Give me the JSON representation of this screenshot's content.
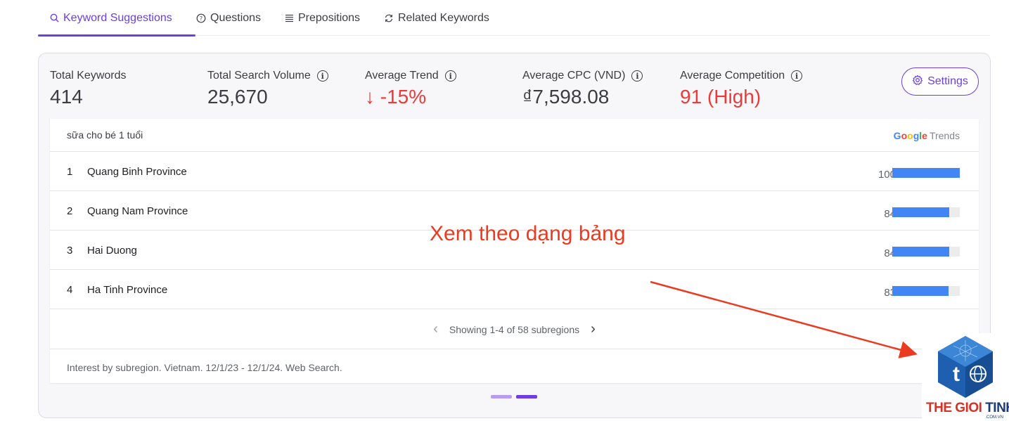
{
  "tabs": [
    {
      "label": "Keyword Suggestions",
      "active": true,
      "icon": "search-icon"
    },
    {
      "label": "Questions",
      "active": false,
      "icon": "question-circle-icon"
    },
    {
      "label": "Prepositions",
      "active": false,
      "icon": "list-icon"
    },
    {
      "label": "Related Keywords",
      "active": false,
      "icon": "refresh-icon"
    }
  ],
  "stats": {
    "total_keywords": {
      "label": "Total Keywords",
      "value": "414"
    },
    "total_search_volume": {
      "label": "Total Search Volume",
      "value": "25,670"
    },
    "average_trend": {
      "label": "Average Trend",
      "value": "↓ -15%"
    },
    "average_cpc": {
      "label": "Average CPC (VND)",
      "value": "₫7,598.08"
    },
    "average_competition": {
      "label": "Average Competition",
      "value": "91 (High)"
    }
  },
  "settings_label": "Settings",
  "trends": {
    "keyword": "sữa cho bé 1 tuổi",
    "brand_google": "Google",
    "brand_trends": "Trends",
    "rows": [
      {
        "rank": "1",
        "name": "Quang Binh Province",
        "score": "100",
        "fill": 100
      },
      {
        "rank": "2",
        "name": "Quang Nam Province",
        "score": "84",
        "fill": 84
      },
      {
        "rank": "3",
        "name": "Hai Duong",
        "score": "84",
        "fill": 84
      },
      {
        "rank": "4",
        "name": "Ha Tinh Province",
        "score": "83",
        "fill": 83
      }
    ],
    "pager_text": "Showing 1-4 of 58 subregions",
    "footnote": "Interest by subregion. Vietnam. 12/1/23 - 12/1/24. Web Search."
  },
  "annotation": "Xem theo dạng bảng",
  "colors": {
    "accent": "#6d3fe0",
    "negative": "#ea3a3a",
    "bar": "#4285f4",
    "annotation": "#ea3a1f"
  },
  "watermark": {
    "brand_a": "THE GIOI ",
    "brand_b": "TINHOC",
    "domain": ".COM.VN"
  }
}
